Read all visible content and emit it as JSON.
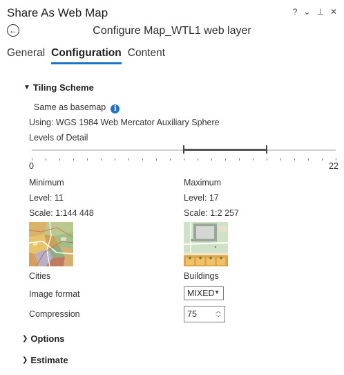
{
  "pane": {
    "title": "Share As Web Map",
    "controls": {
      "help": "?",
      "options": "⌄",
      "pin": "⊥",
      "close": "✕"
    },
    "back_icon": "back-arrow-icon",
    "subtitle": "Configure Map_WTL1 web layer"
  },
  "tabs": [
    {
      "label": "General",
      "active": false
    },
    {
      "label": "Configuration",
      "active": true
    },
    {
      "label": "Content",
      "active": false
    }
  ],
  "tiling": {
    "header": "Tiling Scheme",
    "expanded": true,
    "same_as_basemap": "Same as basemap",
    "using": "Using:  WGS 1984 Web Mercator Auxiliary Sphere",
    "lod_label": "Levels of Detail",
    "lod_min_label": "0",
    "lod_max_label": "22",
    "lod_range_min": 0,
    "lod_range_max": 22,
    "lod_selected_min": 11,
    "lod_selected_max": 17
  },
  "minimum": {
    "header": "Minimum",
    "level": "Level:  11",
    "scale": "Scale:  1:144 448",
    "caption": "Cities"
  },
  "maximum": {
    "header": "Maximum",
    "level": "Level:  17",
    "scale": "Scale:  1:2 257",
    "caption": "Buildings"
  },
  "image_format": {
    "label": "Image format",
    "value": "MIXED"
  },
  "compression": {
    "label": "Compression",
    "value": "75"
  },
  "options_header": "Options",
  "estimate_header": "Estimate",
  "colors": {
    "accent": "#1e72c7"
  }
}
